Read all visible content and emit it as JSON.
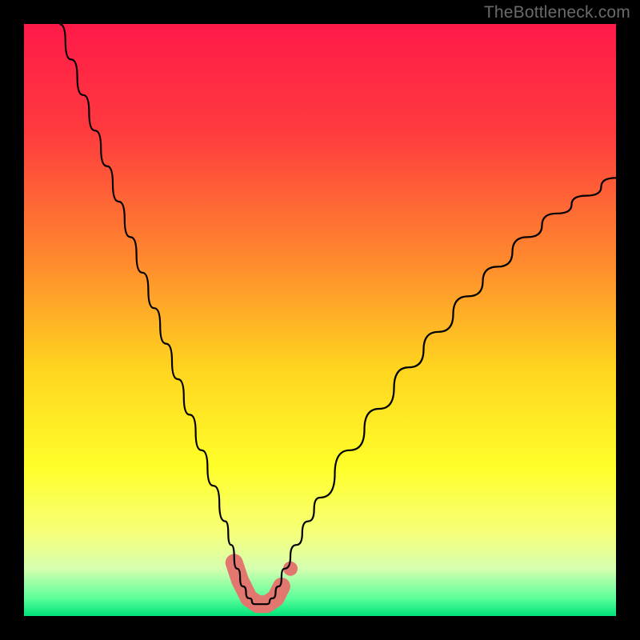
{
  "watermark": "TheBottleneck.com",
  "chart_data": {
    "type": "line",
    "title": "",
    "xlabel": "",
    "ylabel": "",
    "xlim": [
      0,
      100
    ],
    "ylim": [
      0,
      100
    ],
    "grid": false,
    "legend": false,
    "background_gradient": {
      "stops": [
        {
          "offset": 0.0,
          "color": "#ff1a49"
        },
        {
          "offset": 0.18,
          "color": "#ff3a3e"
        },
        {
          "offset": 0.4,
          "color": "#ff8a2e"
        },
        {
          "offset": 0.58,
          "color": "#ffd41f"
        },
        {
          "offset": 0.75,
          "color": "#ffff2a"
        },
        {
          "offset": 0.86,
          "color": "#f6ff7a"
        },
        {
          "offset": 0.92,
          "color": "#d6ffb0"
        },
        {
          "offset": 0.97,
          "color": "#5cff9a"
        },
        {
          "offset": 1.0,
          "color": "#00e37a"
        }
      ]
    },
    "series": [
      {
        "name": "bottleneck-curve",
        "color": "#000000",
        "x": [
          6,
          8,
          10,
          12,
          14,
          16,
          18,
          20,
          22,
          24,
          26,
          28,
          30,
          32,
          34,
          35,
          36,
          37,
          38,
          39,
          40,
          41,
          42,
          43,
          44,
          46,
          48,
          50,
          55,
          60,
          65,
          70,
          75,
          80,
          85,
          90,
          95,
          100
        ],
        "y": [
          100,
          94,
          88,
          82,
          76,
          70,
          64,
          58,
          52,
          46,
          40,
          34,
          28,
          22,
          16,
          12,
          8,
          5,
          3,
          2,
          2,
          2,
          3,
          5,
          8,
          12,
          16,
          20,
          28,
          35,
          42,
          48,
          54,
          59,
          64,
          68,
          71,
          74
        ]
      }
    ],
    "markers": [
      {
        "name": "curve-bottom-band",
        "shape": "rounded-segment",
        "color": "#e2776f",
        "points": [
          {
            "x": 35.5,
            "y": 9
          },
          {
            "x": 36.5,
            "y": 6
          },
          {
            "x": 38.0,
            "y": 3
          },
          {
            "x": 39.5,
            "y": 2
          },
          {
            "x": 41.0,
            "y": 2
          },
          {
            "x": 42.5,
            "y": 3
          },
          {
            "x": 43.5,
            "y": 5
          }
        ],
        "dot": {
          "x": 45.0,
          "y": 8
        }
      }
    ]
  }
}
